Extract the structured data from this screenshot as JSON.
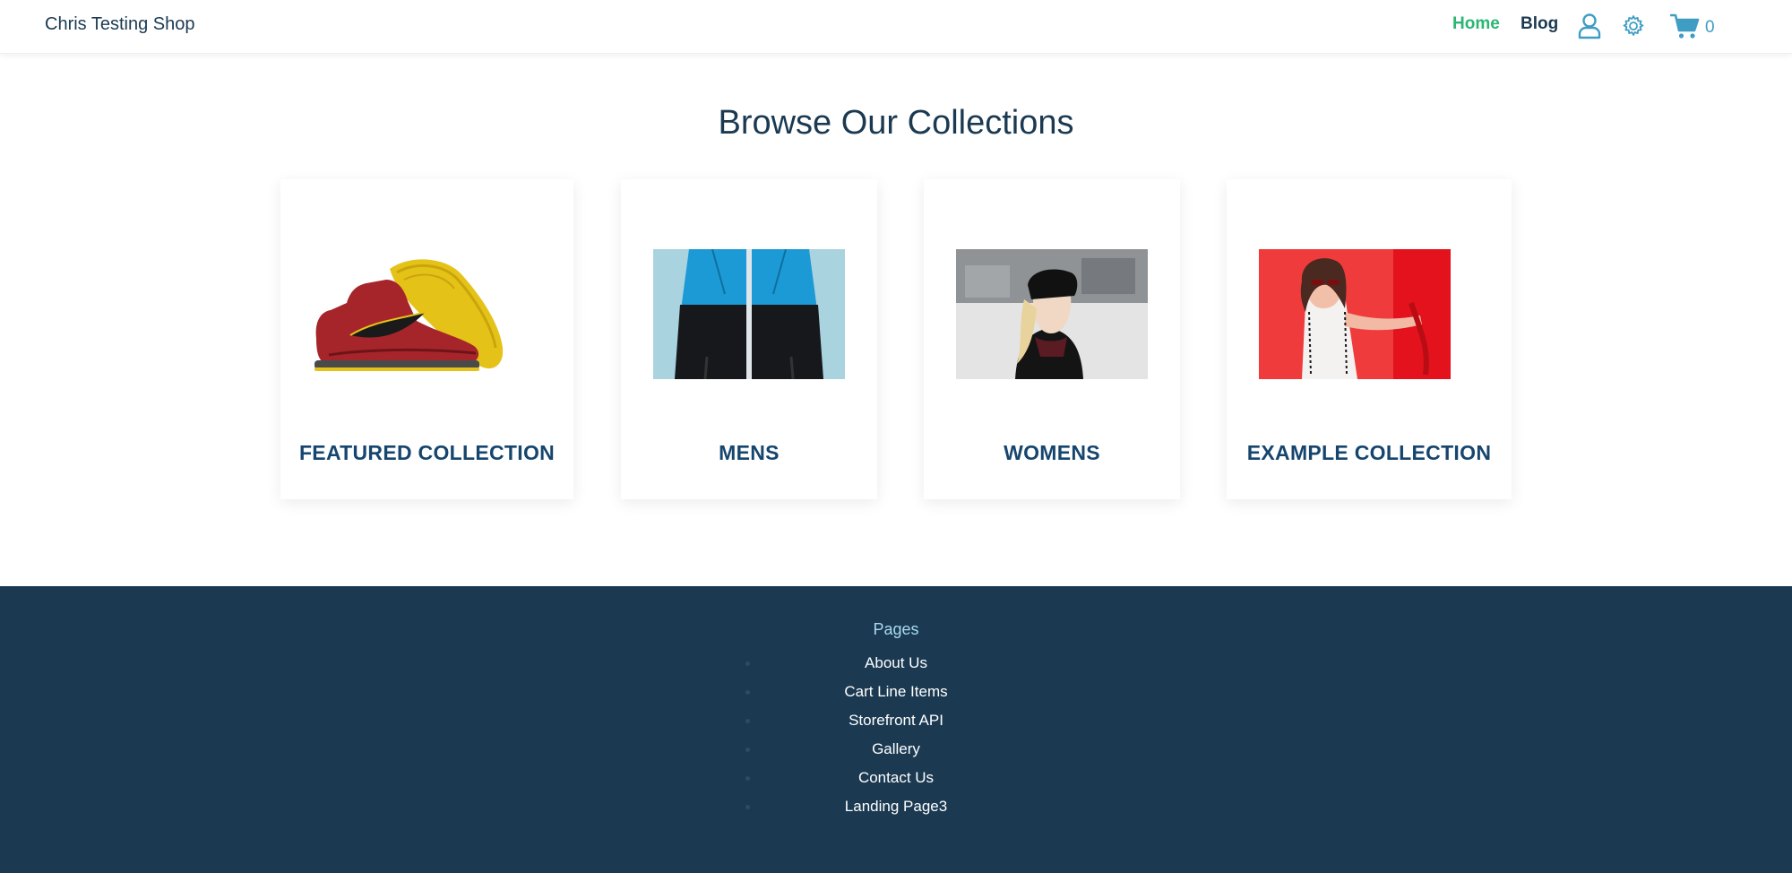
{
  "header": {
    "shop_name": "Chris Testing Shop",
    "nav": {
      "home": "Home",
      "blog": "Blog"
    },
    "cart_count": "0"
  },
  "main": {
    "title": "Browse Our Collections",
    "collections": [
      {
        "label": "FEATURED COLLECTION",
        "image_icon": "sneaker-image"
      },
      {
        "label": "MENS",
        "image_icon": "jacket-image"
      },
      {
        "label": "WOMENS",
        "image_icon": "woman-hat-image"
      },
      {
        "label": "EXAMPLE COLLECTION",
        "image_icon": "woman-red-image"
      }
    ]
  },
  "footer": {
    "heading": "Pages",
    "links": [
      "About Us",
      "Cart Line Items",
      "Storefront API",
      "Gallery",
      "Contact Us",
      "Landing Page3"
    ]
  },
  "colors": {
    "accent_green": "#2bb673",
    "navy": "#1b3a52",
    "label_blue": "#16456e",
    "footer_bg": "#1b3a52",
    "icon_teal": "#3f9dc4"
  }
}
